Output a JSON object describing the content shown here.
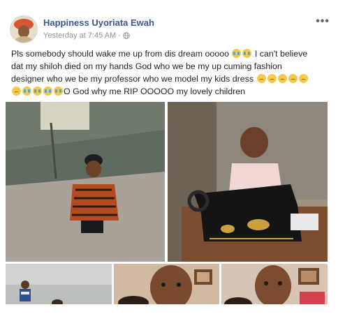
{
  "post": {
    "author_name": "Happiness Uyoriata Ewah",
    "timestamp": "Yesterday at 7:45 AM",
    "separator": "·",
    "privacy_icon": "globe-icon",
    "more_menu": "•••",
    "text": {
      "line1_a": "Pls somebody should wake me up from dis dream ooooo",
      "line1_b": "I can't believe",
      "line2": "dat my shiloh died on my hands God who we be my up cuming fashion",
      "line3": "designer who we be my professor who we model my kids dress",
      "line4": "O God why me RIP OOOOO my lovely children"
    }
  },
  "colors": {
    "name": "#385898",
    "meta": "#90949c",
    "text": "#1d2129"
  }
}
